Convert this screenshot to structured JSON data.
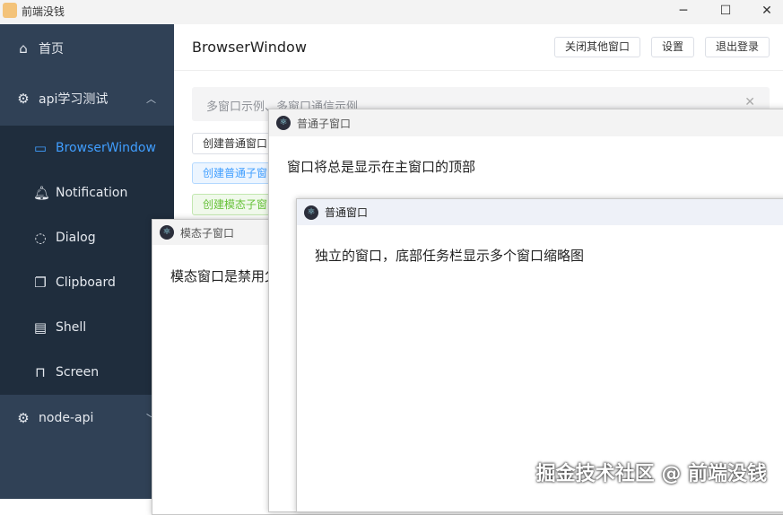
{
  "app": {
    "title": "前端没钱",
    "minimize": "─",
    "maximize": "☐",
    "close": "✕"
  },
  "sidebar": {
    "items": [
      {
        "label": "首页",
        "icon": "home-icon"
      },
      {
        "label": "api学习测试",
        "icon": "gear-icon"
      },
      {
        "label": "BrowserWindow",
        "icon": "monitor-icon"
      },
      {
        "label": "Notification",
        "icon": "bell-icon"
      },
      {
        "label": "Dialog",
        "icon": "chat-icon"
      },
      {
        "label": "Clipboard",
        "icon": "copy-icon"
      },
      {
        "label": "Shell",
        "icon": "terminal-icon"
      },
      {
        "label": "Screen",
        "icon": "screen-icon"
      },
      {
        "label": "node-api",
        "icon": "gear-icon"
      }
    ]
  },
  "header": {
    "title": "BrowserWindow",
    "buttons": [
      "关闭其他窗口",
      "设置",
      "退出登录"
    ]
  },
  "alert": {
    "text": "多窗口示例、多窗口通信示例"
  },
  "buttons": [
    "创建普通窗口",
    "创建普通子窗口",
    "创建模态子窗口"
  ],
  "windows": {
    "modal": {
      "title": "模态子窗口",
      "body": "模态窗口是禁用父窗口的子窗口"
    },
    "child": {
      "title": "普通子窗口",
      "body": "窗口将总是显示在主窗口的顶部"
    },
    "normal": {
      "title": "普通窗口",
      "body": "独立的窗口，底部任务栏显示多个窗口缩略图"
    }
  },
  "watermark": "掘金技术社区 @ 前端没钱"
}
